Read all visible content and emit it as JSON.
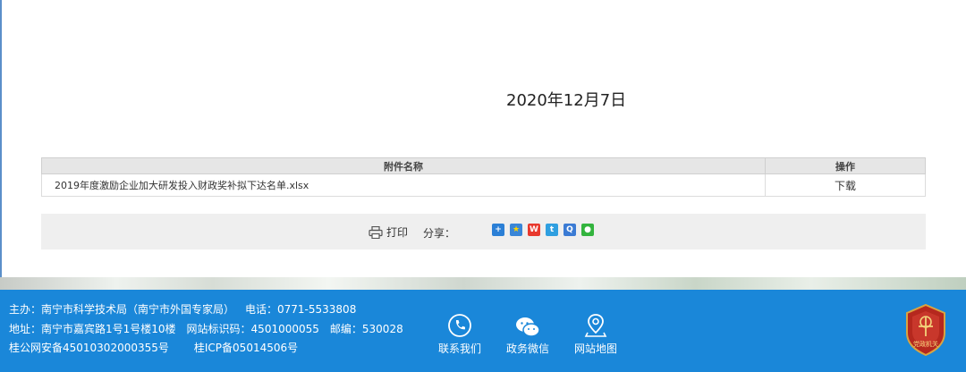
{
  "article": {
    "date": "2020年12月7日"
  },
  "attachments": {
    "headers": {
      "name": "附件名称",
      "action": "操作"
    },
    "rows": [
      {
        "name": "2019年度激励企业加大研发投入财政奖补拟下达名单.xlsx",
        "action": "下载"
      }
    ]
  },
  "share_bar": {
    "print_label": "打印",
    "share_label": "分享：",
    "icons": [
      "share-more-icon",
      "qzone-icon",
      "weibo-icon",
      "tencent-weibo-icon",
      "qq-icon",
      "wechat-icon"
    ]
  },
  "footer": {
    "line1": {
      "host": "主办：南宁市科学技术局（南宁市外国专家局）",
      "phone": "电话：0771-5533808"
    },
    "line2": {
      "address": "地址：南宁市嘉宾路1号1号楼10楼",
      "site_code": "网站标识码：4501000055",
      "postcode": "邮编：530028"
    },
    "line3": {
      "police": "桂公网安备45010302000355号",
      "icp": "桂ICP备05014506号"
    },
    "links": [
      {
        "label": "联系我们",
        "icon": "phone-icon"
      },
      {
        "label": "政务微信",
        "icon": "wechat-icon"
      },
      {
        "label": "网站地图",
        "icon": "map-pin-icon"
      }
    ],
    "badge_text": "党政机关",
    "colors": {
      "footer_bg": "#1a87d9",
      "badge_red": "#b5281e"
    }
  }
}
